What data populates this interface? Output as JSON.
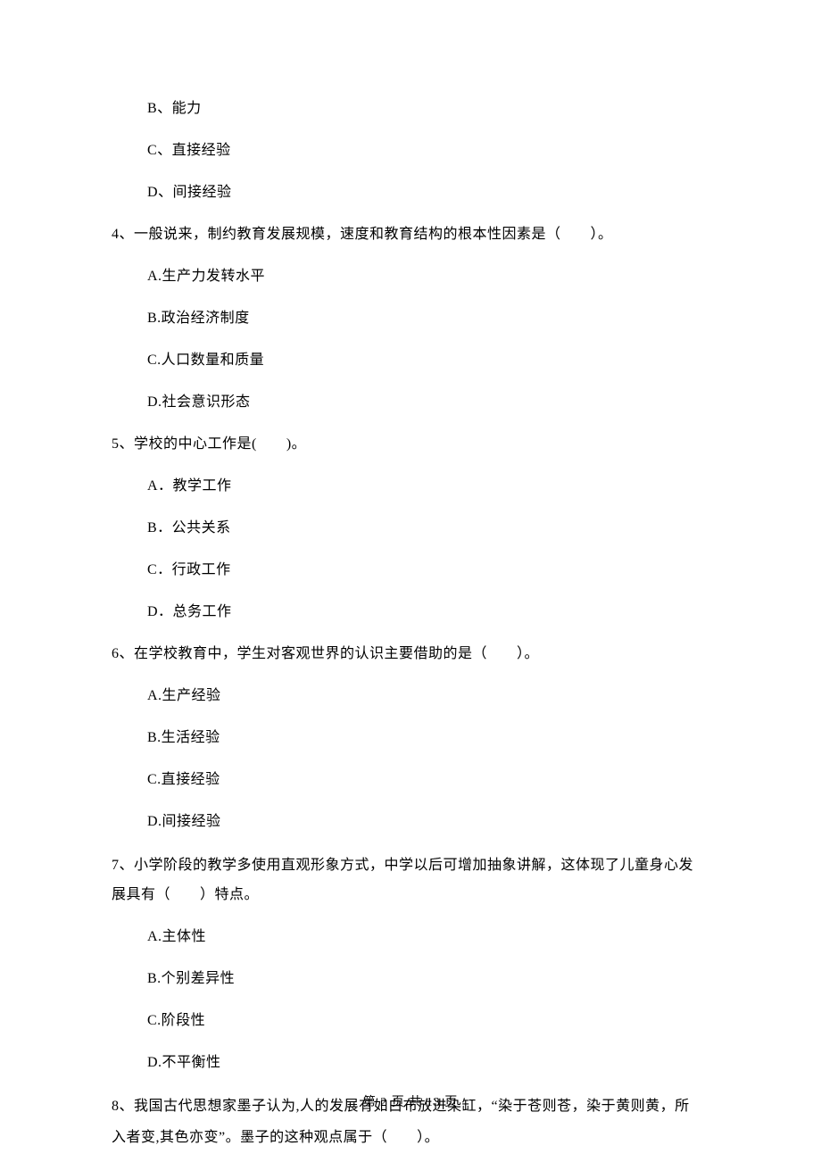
{
  "options_prev": {
    "b": "B、能力",
    "c": "C、直接经验",
    "d": "D、间接经验"
  },
  "q4": {
    "stem": "4、一般说来，制约教育发展规模，速度和教育结构的根本性因素是（　　）。",
    "a": "A.生产力发转水平",
    "b": "B.政治经济制度",
    "c": "C.人口数量和质量",
    "d": "D.社会意识形态"
  },
  "q5": {
    "stem": "5、学校的中心工作是(　　)。",
    "a": "A．教学工作",
    "b": "B．公共关系",
    "c": "C．行政工作",
    "d": "D．总务工作"
  },
  "q6": {
    "stem": "6、在学校教育中，学生对客观世界的认识主要借助的是（　　）。",
    "a": "A.生产经验",
    "b": "B.生活经验",
    "c": "C.直接经验",
    "d": "D.间接经验"
  },
  "q7": {
    "stem_line1": "7、小学阶段的教学多使用直观形象方式，中学以后可增加抽象讲解，这体现了儿童身心发",
    "stem_line2": "展具有（　　）特点。",
    "a": "A.主体性",
    "b": "B.个别差异性",
    "c": "C.阶段性",
    "d": "D.不平衡性"
  },
  "q8": {
    "stem_line1": "8、我国古代思想家墨子认为,人的发展有如白布放进染缸，“染于苍则苍，染于黄则黄，所",
    "stem_line2": "入者变,其色亦变”。墨子的这种观点属于（　　）。"
  },
  "footer": "第 2 页 共 13 页"
}
